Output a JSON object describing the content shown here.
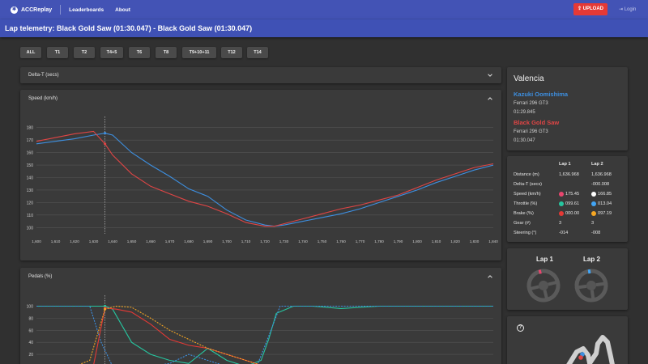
{
  "app": {
    "brand": "ACCReplay",
    "nav": [
      "Leaderboards",
      "About"
    ],
    "upload_label": "UPLOAD",
    "login_label": "Login"
  },
  "page_title": "Lap telemetry: Black Gold Saw (01:30.047) - Black Gold Saw (01:30.047)",
  "corner_filters": [
    "ALL",
    "T1",
    "T2",
    "T4+5",
    "T6",
    "T8",
    "T9+10+11",
    "T12",
    "T14"
  ],
  "panels": {
    "delta_title": "Delta-T (secs)",
    "speed_title": "Speed (km/h)",
    "pedals_title": "Pedals (%)"
  },
  "session": {
    "track": "Valencia",
    "driver1": {
      "name": "Kazuki Oomishima",
      "car": "Ferrari 296 GT3",
      "time": "01:29.845"
    },
    "driver2": {
      "name": "Black Gold Saw",
      "car": "Ferrari 296 GT3",
      "time": "01:30.047"
    }
  },
  "lap_table": {
    "headers": [
      "Lap 1",
      "Lap 2"
    ],
    "rows": [
      {
        "label": "Distance (m)",
        "lap1": "1,636.968",
        "lap2": "1,636.968"
      },
      {
        "label": "Delta-T (secs)",
        "lap1": "",
        "lap2": "-000.008"
      },
      {
        "label": "Speed (km/h)",
        "lap1": "175.45",
        "lap2": "166.85"
      },
      {
        "label": "Throttle (%)",
        "lap1": "099.61",
        "lap2": "013.04"
      },
      {
        "label": "Brake (%)",
        "lap1": "000.00",
        "lap2": "097.19"
      },
      {
        "label": "Gear (#)",
        "lap1": "3",
        "lap2": "3"
      },
      {
        "label": "Steering (°)",
        "lap1": "-014",
        "lap2": "-008"
      }
    ],
    "dot_colors": {
      "speed": [
        "#e8466e",
        "#ffffff"
      ],
      "throttle": [
        "#26c6a0",
        "#42a5f5"
      ],
      "brake": [
        "#e53935",
        "#f5a623"
      ]
    }
  },
  "wheels": {
    "lap1_label": "Lap 1",
    "lap2_label": "Lap 2",
    "lap1_marker_color": "#e8466e",
    "lap2_marker_color": "#42a5f5"
  },
  "colors": {
    "nav": "#4353b5",
    "lap1": "#3d8fe0",
    "lap2": "#e04545",
    "upload": "#e53935"
  },
  "chart_data": [
    {
      "type": "line",
      "title": "Speed (km/h)",
      "xlim": [
        1600,
        1640
      ],
      "ylim": [
        95,
        185
      ],
      "x_ticks": [
        1600,
        1610,
        1620,
        1630,
        1640,
        1650,
        1660,
        1670,
        1680,
        1690,
        1700,
        1710,
        1720,
        1730,
        1740,
        1750,
        1760,
        1770,
        1780,
        1790,
        1800,
        1810,
        1820,
        1830,
        1840
      ],
      "x_tick_labels": [
        "1,600",
        "1,610",
        "1,620",
        "1,630",
        "1,640",
        "1,650",
        "1,660",
        "1,670",
        "1,680",
        "1,690",
        "1,700",
        "1,710",
        "1,720",
        "1,730",
        "1,740",
        "1,750",
        "1,760",
        "1,770",
        "1,780",
        "1,790",
        "1,800",
        "1,810",
        "1,820",
        "1,830",
        "1,840"
      ],
      "y_ticks": [
        100,
        110,
        120,
        130,
        140,
        150,
        160,
        170,
        180
      ],
      "cursor_x": 1636,
      "series": [
        {
          "name": "Lap 1",
          "color": "#3d8fe0",
          "x": [
            1600,
            1610,
            1620,
            1630,
            1636,
            1640,
            1650,
            1660,
            1670,
            1680,
            1690,
            1700,
            1710,
            1720,
            1725,
            1730,
            1740,
            1750,
            1760,
            1770,
            1780,
            1790,
            1800,
            1810,
            1820,
            1830,
            1840
          ],
          "y": [
            167,
            169,
            171,
            174,
            175.5,
            174,
            160,
            150,
            141,
            131,
            125,
            114,
            106,
            102,
            101,
            102,
            105,
            108,
            111,
            115,
            120,
            125,
            130,
            136,
            141,
            146,
            150
          ]
        },
        {
          "name": "Lap 2",
          "color": "#e04545",
          "x": [
            1600,
            1610,
            1620,
            1630,
            1636,
            1640,
            1650,
            1660,
            1670,
            1680,
            1690,
            1700,
            1710,
            1720,
            1725,
            1730,
            1740,
            1750,
            1760,
            1770,
            1780,
            1790,
            1800,
            1810,
            1820,
            1830,
            1840
          ],
          "y": [
            169,
            172,
            175,
            177,
            167,
            158,
            143,
            133,
            127,
            121,
            117,
            111,
            104,
            101,
            101,
            103,
            107,
            111,
            115,
            118,
            122,
            126,
            132,
            138,
            143,
            148,
            151
          ]
        }
      ]
    },
    {
      "type": "line",
      "title": "Pedals (%)",
      "xlim": [
        1600,
        1840
      ],
      "ylim": [
        0,
        110
      ],
      "y_ticks": [
        20,
        40,
        60,
        80,
        100
      ],
      "cursor_x": 1636,
      "series": [
        {
          "name": "Lap 1 throttle",
          "color": "#26c6a0",
          "dash": false,
          "x": [
            1600,
            1625,
            1630,
            1636,
            1640,
            1650,
            1660,
            1670,
            1680,
            1690,
            1700,
            1710,
            1718,
            1722,
            1726,
            1735,
            1745,
            1760,
            1780,
            1840
          ],
          "y": [
            100,
            100,
            100,
            100,
            95,
            40,
            20,
            10,
            5,
            30,
            10,
            0,
            10,
            45,
            88,
            100,
            100,
            96,
            100,
            100
          ]
        },
        {
          "name": "Lap 1 brake",
          "color": "#3d8fe0",
          "dash": true,
          "x": [
            1600,
            1620,
            1628,
            1634,
            1640,
            1650,
            1660,
            1670,
            1680,
            1690,
            1700,
            1710,
            1716,
            1722,
            1728,
            1840
          ],
          "y": [
            100,
            100,
            100,
            40,
            0,
            0,
            0,
            5,
            20,
            10,
            0,
            0,
            2,
            50,
            100,
            100
          ]
        },
        {
          "name": "Lap 2 brake",
          "color": "#e53935",
          "dash": false,
          "x": [
            1600,
            1620,
            1630,
            1636,
            1642,
            1650,
            1660,
            1670,
            1680,
            1690,
            1700,
            1710,
            1720
          ],
          "y": [
            0,
            0,
            2,
            97,
            95,
            90,
            70,
            45,
            35,
            30,
            20,
            10,
            0
          ]
        },
        {
          "name": "Lap 2 throttle",
          "color": "#f5a623",
          "dash": true,
          "x": [
            1600,
            1620,
            1628,
            1636,
            1642,
            1650,
            1660,
            1670,
            1680,
            1690,
            1700,
            1710,
            1720
          ],
          "y": [
            0,
            0,
            10,
            95,
            100,
            98,
            80,
            60,
            45,
            30,
            20,
            10,
            0
          ]
        }
      ]
    }
  ]
}
